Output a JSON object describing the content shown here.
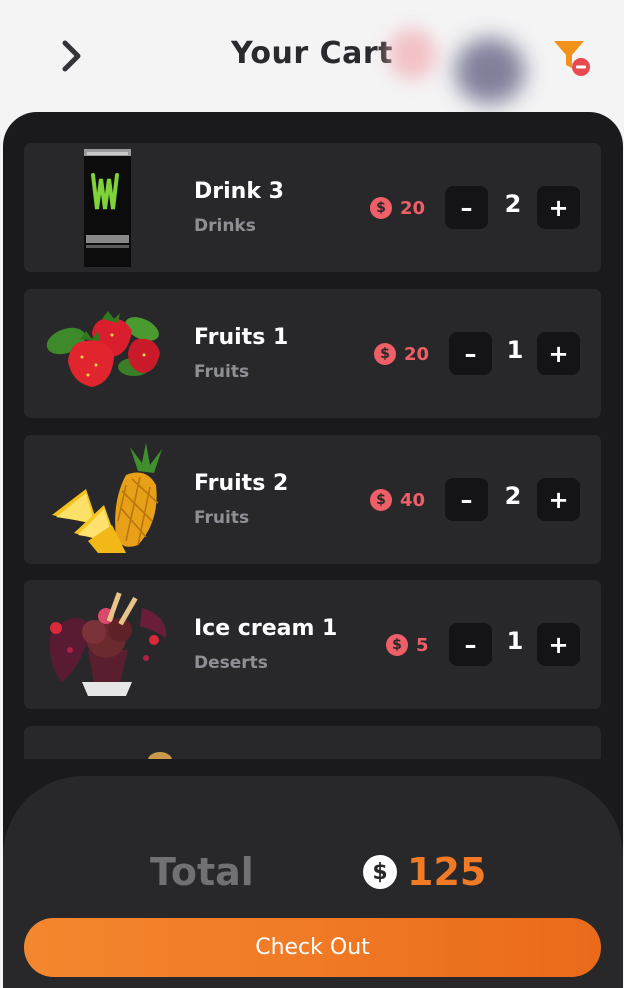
{
  "header": {
    "title": "Your Cart"
  },
  "currency_symbol": "$",
  "colors": {
    "accent": "#f07a26",
    "price": "#ee5f67",
    "card": "#28282b",
    "panel": "#1a1a1c"
  },
  "cart": {
    "items": [
      {
        "name": "Drink 3",
        "category": "Drinks",
        "price": "20",
        "quantity": "2",
        "image": "energy-drink-can"
      },
      {
        "name": "Fruits 1",
        "category": "Fruits",
        "price": "20",
        "quantity": "1",
        "image": "strawberries"
      },
      {
        "name": "Fruits 2",
        "category": "Fruits",
        "price": "40",
        "quantity": "2",
        "image": "pineapple"
      },
      {
        "name": "Ice cream 1",
        "category": "Deserts",
        "price": "5",
        "quantity": "1",
        "image": "ice-cream-sundae"
      }
    ]
  },
  "controls": {
    "minus": "–",
    "plus": "+"
  },
  "footer": {
    "total_label": "Total",
    "total_value": "125",
    "checkout_label": "Check Out"
  }
}
